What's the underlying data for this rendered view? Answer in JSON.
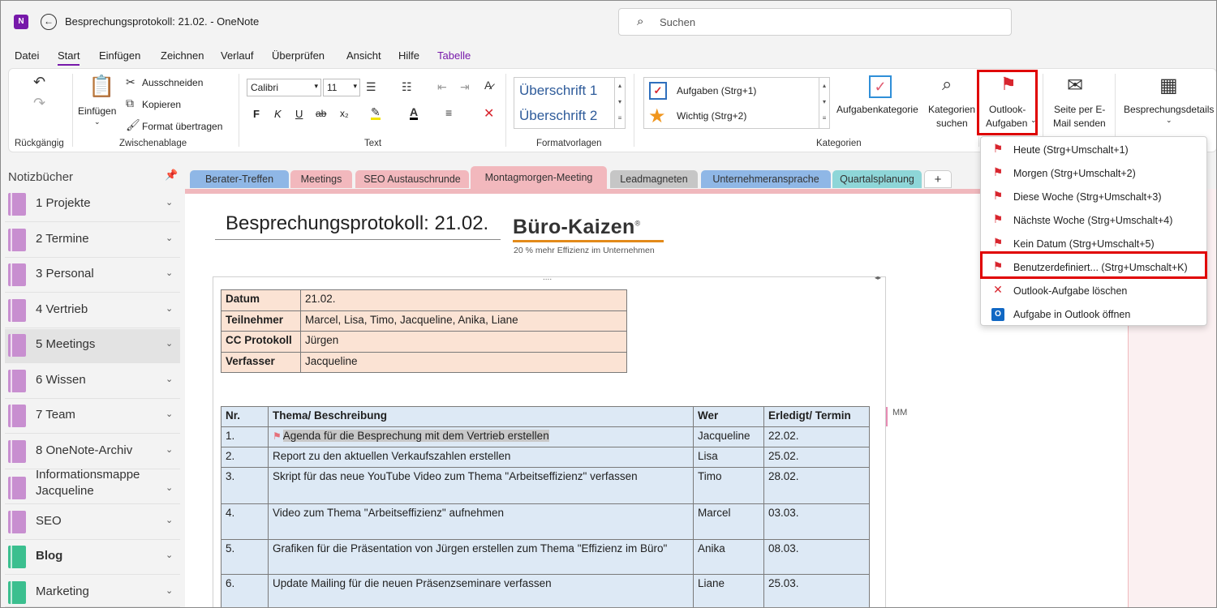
{
  "window": {
    "title": "Besprechungsprotokoll: 21.02.  -  OneNote",
    "search_placeholder": "Suchen",
    "app_icon": "onenote-icon"
  },
  "menu": [
    "Datei",
    "Start",
    "Einfügen",
    "Zeichnen",
    "Verlauf",
    "Überprüfen",
    "Ansicht",
    "Hilfe",
    "Tabelle"
  ],
  "ribbon": {
    "undo_group": "Rückgängig",
    "clipboard": {
      "paste": "Einfügen",
      "cut": "Ausschneiden",
      "copy": "Kopieren",
      "format_painter": "Format übertragen",
      "group": "Zwischenablage"
    },
    "text": {
      "font": "Calibri",
      "size": "11",
      "bold": "F",
      "italic": "K",
      "underline": "U",
      "strike": "ab",
      "subscript": "x₂",
      "group": "Text"
    },
    "styles": {
      "h1": "Überschrift 1",
      "h2": "Überschrift 2",
      "group": "Formatvorlagen"
    },
    "tags": {
      "task": "Aufgaben (Strg+1)",
      "important": "Wichtig (Strg+2)",
      "task_category": "Aufgabenkategorie",
      "find_line1": "Kategorien",
      "find_line2": "suchen",
      "group": "Kategorien"
    },
    "outlook_tasks_line1": "Outlook-",
    "outlook_tasks_line2": "Aufgaben",
    "email_line1": "Seite per E-",
    "email_line2": "Mail senden",
    "meeting_details": "Besprechungsdetails"
  },
  "dropdown": [
    {
      "label": "Heute  (Strg+Umschalt+1)",
      "icon": "flag-icon"
    },
    {
      "label": "Morgen  (Strg+Umschalt+2)",
      "icon": "flag-icon"
    },
    {
      "label": "Diese Woche  (Strg+Umschalt+3)",
      "icon": "flag-icon"
    },
    {
      "label": "Nächste Woche  (Strg+Umschalt+4)",
      "icon": "flag-icon"
    },
    {
      "label": "Kein Datum  (Strg+Umschalt+5)",
      "icon": "flag-icon"
    },
    {
      "label": "Benutzerdefiniert...  (Strg+Umschalt+K)",
      "icon": "flag-icon"
    },
    {
      "label": "Outlook-Aufgabe löschen",
      "icon": "delete-x-icon"
    },
    {
      "label": "Aufgabe in Outlook öffnen",
      "icon": "outlook-icon"
    }
  ],
  "notebooks": {
    "header": "Notizbücher",
    "items": [
      {
        "label": "1 Projekte",
        "color": "#c88fd0"
      },
      {
        "label": "2 Termine",
        "color": "#c88fd0"
      },
      {
        "label": "3 Personal",
        "color": "#c88fd0"
      },
      {
        "label": "4 Vertrieb",
        "color": "#c88fd0"
      },
      {
        "label": "5 Meetings",
        "color": "#c88fd0"
      },
      {
        "label": "6 Wissen",
        "color": "#c88fd0"
      },
      {
        "label": "7 Team",
        "color": "#c88fd0"
      },
      {
        "label": "8 OneNote-Archiv",
        "color": "#c88fd0"
      },
      {
        "label": "Informationsmappe Jacqueline",
        "color": "#c88fd0"
      },
      {
        "label": "SEO",
        "color": "#c88fd0"
      },
      {
        "label": "Blog",
        "color": "#3bbf8f"
      },
      {
        "label": "Marketing",
        "color": "#3bbf8f"
      }
    ]
  },
  "sections": [
    {
      "label": "Berater-Treffen",
      "color": "#8fb7e6"
    },
    {
      "label": "Meetings",
      "color": "#f2b8bd"
    },
    {
      "label": "SEO Austauschrunde",
      "color": "#f2b8bd"
    },
    {
      "label": "Montagmorgen-Meeting",
      "color": "#f2b8bd"
    },
    {
      "label": "Leadmagneten",
      "color": "#c6c6c6"
    },
    {
      "label": "Unternehmeransprache",
      "color": "#8fb7e6"
    },
    {
      "label": "Quartalsplanung",
      "color": "#8ed6d8"
    },
    {
      "label": "+",
      "color": "#ffffff"
    }
  ],
  "page": {
    "title": "Besprechungsprotokoll: 21.02.",
    "logo_text": "Büro-Kaizen",
    "logo_reg": "®",
    "logo_sub": "20 % mehr Effizienz im Unternehmen",
    "container_handle": "....",
    "container_arrows": "◂▸",
    "info": [
      {
        "label": "Datum",
        "value": "21.02."
      },
      {
        "label": "Teilnehmer",
        "value": "Marcel, Lisa, Timo, Jacqueline, Anika, Liane"
      },
      {
        "label": "CC Protokoll",
        "value": "Jürgen"
      },
      {
        "label": "Verfasser",
        "value": "Jacqueline"
      }
    ],
    "tasks_header": {
      "nr": "Nr.",
      "topic": "Thema/ Beschreibung",
      "who": "Wer",
      "done": "Erledigt/ Termin"
    },
    "tasks": [
      {
        "nr": "1.",
        "topic": "Agenda für die Besprechung mit dem Vertrieb erstellen",
        "who": "Jacqueline",
        "done": "22.02."
      },
      {
        "nr": "2.",
        "topic": "Report zu den aktuellen Verkaufszahlen erstellen",
        "who": "Lisa",
        "done": "25.02."
      },
      {
        "nr": "3.",
        "topic": "Skript für das neue YouTube Video zum Thema \"Arbeitseffizienz\" verfassen",
        "who": "Timo",
        "done": "28.02."
      },
      {
        "nr": "4.",
        "topic": "Video zum Thema \"Arbeitseffizienz\" aufnehmen",
        "who": "Marcel",
        "done": "03.03."
      },
      {
        "nr": "5.",
        "topic": "Grafiken für die Präsentation von Jürgen erstellen zum Thema \"Effizienz im Büro\"",
        "who": "Anika",
        "done": "08.03."
      },
      {
        "nr": "6.",
        "topic": "Update Mailing für die neuen Präsenzseminare verfassen",
        "who": "Liane",
        "done": "25.03."
      }
    ],
    "author_tag": "MM"
  },
  "colors": {
    "accent": "#7719aa",
    "highlight": "#e00000"
  }
}
